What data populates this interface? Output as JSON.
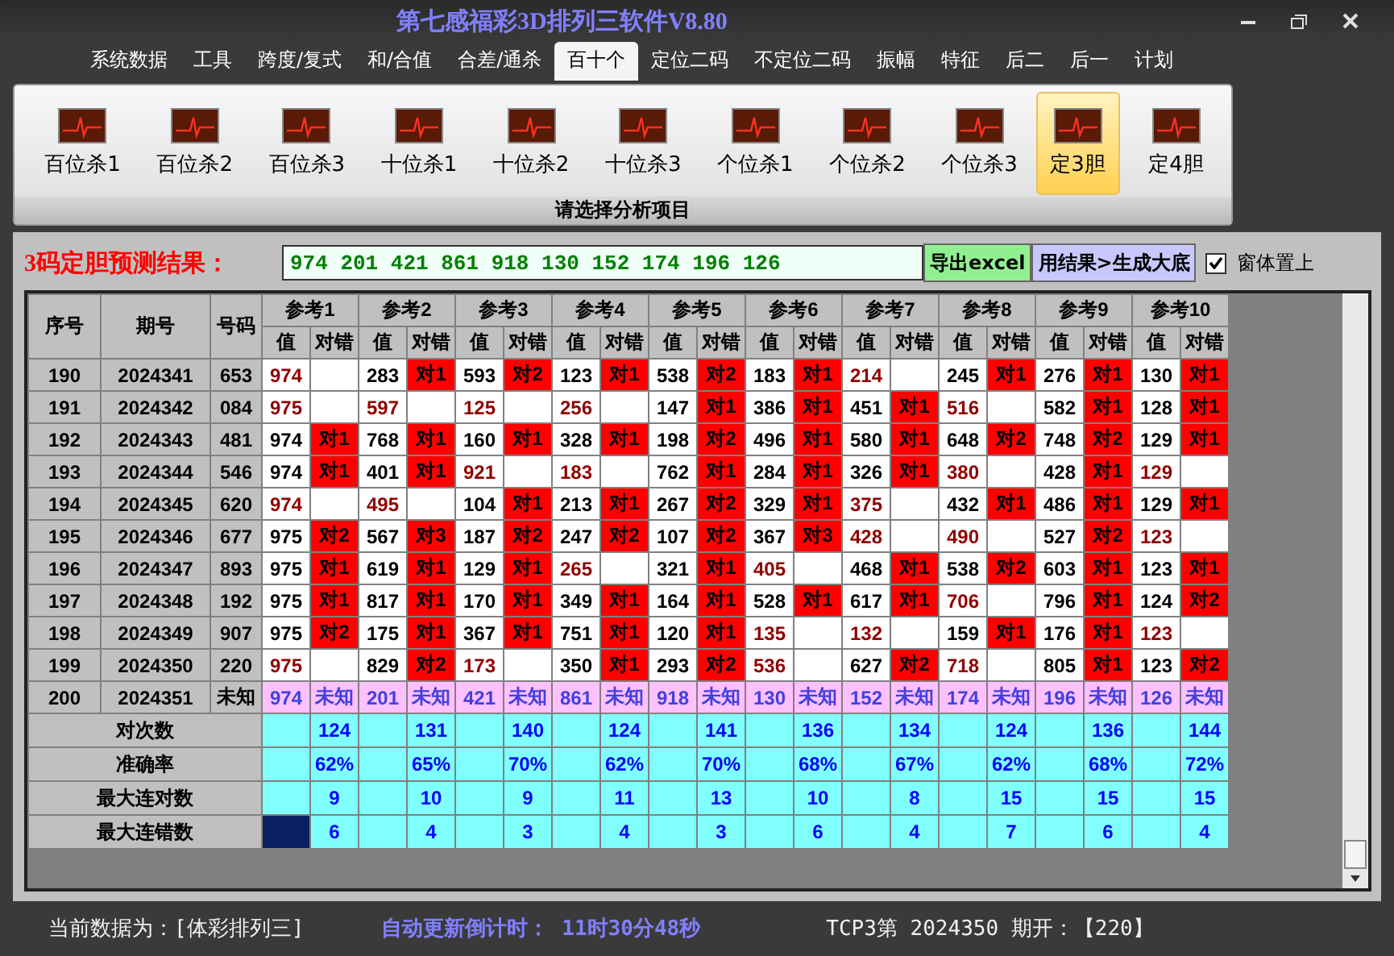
{
  "window": {
    "title": "第七感福彩3D排列三软件V8.80"
  },
  "menu": [
    {
      "label": "系统数据",
      "selected": false
    },
    {
      "label": "工具",
      "selected": false
    },
    {
      "label": "跨度/复式",
      "selected": false
    },
    {
      "label": "和/合值",
      "selected": false
    },
    {
      "label": "合差/通杀",
      "selected": false
    },
    {
      "label": "百十个",
      "selected": true
    },
    {
      "label": "定位二码",
      "selected": false
    },
    {
      "label": "不定位二码",
      "selected": false
    },
    {
      "label": "振幅",
      "selected": false
    },
    {
      "label": "特征",
      "selected": false
    },
    {
      "label": "后二",
      "selected": false
    },
    {
      "label": "后一",
      "selected": false
    },
    {
      "label": "计划",
      "selected": false
    }
  ],
  "ribbon": {
    "items": [
      {
        "label": "百位杀1",
        "selected": false
      },
      {
        "label": "百位杀2",
        "selected": false
      },
      {
        "label": "百位杀3",
        "selected": false
      },
      {
        "label": "十位杀1",
        "selected": false
      },
      {
        "label": "十位杀2",
        "selected": false
      },
      {
        "label": "十位杀3",
        "selected": false
      },
      {
        "label": "个位杀1",
        "selected": false
      },
      {
        "label": "个位杀2",
        "selected": false
      },
      {
        "label": "个位杀3",
        "selected": false
      },
      {
        "label": "定3胆",
        "selected": true
      },
      {
        "label": "定4胆",
        "selected": false
      }
    ],
    "caption": "请选择分析项目"
  },
  "result": {
    "label": "3码定胆预测结果：",
    "value": "974 201 421 861 918 130 152 174 196 126",
    "buttons": [
      "导出excel",
      "用结果>生成大底"
    ],
    "checkbox": {
      "label": "窗体置上",
      "checked": true
    }
  },
  "table": {
    "columns": [
      "序号",
      "期号",
      "号码"
    ],
    "groups": [
      {
        "label": "参考1",
        "subcolumns": [
          "值",
          "对错"
        ]
      },
      {
        "label": "参考2",
        "subcolumns": [
          "值",
          "对错"
        ]
      },
      {
        "label": "参考3",
        "subcolumns": [
          "值",
          "对错"
        ]
      },
      {
        "label": "参考4",
        "subcolumns": [
          "值",
          "对错"
        ]
      },
      {
        "label": "参考5",
        "subcolumns": [
          "值",
          "对错"
        ]
      },
      {
        "label": "参考6",
        "subcolumns": [
          "值",
          "对错"
        ]
      },
      {
        "label": "参考7",
        "subcolumns": [
          "值",
          "对错"
        ]
      },
      {
        "label": "参考8",
        "subcolumns": [
          "值",
          "对错"
        ]
      },
      {
        "label": "参考9",
        "subcolumns": [
          "值",
          "对错"
        ]
      },
      {
        "label": "参考10",
        "subcolumns": [
          "值",
          "对错"
        ]
      }
    ],
    "rows": [
      {
        "kind": "history",
        "seq": "190",
        "period": "2024341",
        "number": "653",
        "cells": [
          {
            "value": "974",
            "hit": false
          },
          {
            "value": "283",
            "hit": true,
            "result": "对1"
          },
          {
            "value": "593",
            "hit": true,
            "result": "对2"
          },
          {
            "value": "123",
            "hit": true,
            "result": "对1"
          },
          {
            "value": "538",
            "hit": true,
            "result": "对2"
          },
          {
            "value": "183",
            "hit": true,
            "result": "对1"
          },
          {
            "value": "214",
            "hit": false
          },
          {
            "value": "245",
            "hit": true,
            "result": "对1"
          },
          {
            "value": "276",
            "hit": true,
            "result": "对1"
          },
          {
            "value": "130",
            "hit": true,
            "result": "对1"
          }
        ]
      },
      {
        "kind": "history",
        "seq": "191",
        "period": "2024342",
        "number": "084",
        "cells": [
          {
            "value": "975",
            "hit": false
          },
          {
            "value": "597",
            "hit": false
          },
          {
            "value": "125",
            "hit": false
          },
          {
            "value": "256",
            "hit": false
          },
          {
            "value": "147",
            "hit": true,
            "result": "对1"
          },
          {
            "value": "386",
            "hit": true,
            "result": "对1"
          },
          {
            "value": "451",
            "hit": true,
            "result": "对1"
          },
          {
            "value": "516",
            "hit": false
          },
          {
            "value": "582",
            "hit": true,
            "result": "对1"
          },
          {
            "value": "128",
            "hit": true,
            "result": "对1"
          }
        ]
      },
      {
        "kind": "history",
        "seq": "192",
        "period": "2024343",
        "number": "481",
        "cells": [
          {
            "value": "974",
            "hit": true,
            "result": "对1"
          },
          {
            "value": "768",
            "hit": true,
            "result": "对1"
          },
          {
            "value": "160",
            "hit": true,
            "result": "对1"
          },
          {
            "value": "328",
            "hit": true,
            "result": "对1"
          },
          {
            "value": "198",
            "hit": true,
            "result": "对2"
          },
          {
            "value": "496",
            "hit": true,
            "result": "对1"
          },
          {
            "value": "580",
            "hit": true,
            "result": "对1"
          },
          {
            "value": "648",
            "hit": true,
            "result": "对2"
          },
          {
            "value": "748",
            "hit": true,
            "result": "对2"
          },
          {
            "value": "129",
            "hit": true,
            "result": "对1"
          }
        ]
      },
      {
        "kind": "history",
        "seq": "193",
        "period": "2024344",
        "number": "546",
        "cells": [
          {
            "value": "974",
            "hit": true,
            "result": "对1"
          },
          {
            "value": "401",
            "hit": true,
            "result": "对1"
          },
          {
            "value": "921",
            "hit": false
          },
          {
            "value": "183",
            "hit": false
          },
          {
            "value": "762",
            "hit": true,
            "result": "对1"
          },
          {
            "value": "284",
            "hit": true,
            "result": "对1"
          },
          {
            "value": "326",
            "hit": true,
            "result": "对1"
          },
          {
            "value": "380",
            "hit": false
          },
          {
            "value": "428",
            "hit": true,
            "result": "对1"
          },
          {
            "value": "129",
            "hit": false
          }
        ]
      },
      {
        "kind": "history",
        "seq": "194",
        "period": "2024345",
        "number": "620",
        "cells": [
          {
            "value": "974",
            "hit": false
          },
          {
            "value": "495",
            "hit": false
          },
          {
            "value": "104",
            "hit": true,
            "result": "对1"
          },
          {
            "value": "213",
            "hit": true,
            "result": "对1"
          },
          {
            "value": "267",
            "hit": true,
            "result": "对2"
          },
          {
            "value": "329",
            "hit": true,
            "result": "对1"
          },
          {
            "value": "375",
            "hit": false
          },
          {
            "value": "432",
            "hit": true,
            "result": "对1"
          },
          {
            "value": "486",
            "hit": true,
            "result": "对1"
          },
          {
            "value": "129",
            "hit": true,
            "result": "对1"
          }
        ]
      },
      {
        "kind": "history",
        "seq": "195",
        "period": "2024346",
        "number": "677",
        "cells": [
          {
            "value": "975",
            "hit": true,
            "result": "对2"
          },
          {
            "value": "567",
            "hit": true,
            "result": "对3"
          },
          {
            "value": "187",
            "hit": true,
            "result": "对2"
          },
          {
            "value": "247",
            "hit": true,
            "result": "对2"
          },
          {
            "value": "107",
            "hit": true,
            "result": "对2"
          },
          {
            "value": "367",
            "hit": true,
            "result": "对3"
          },
          {
            "value": "428",
            "hit": false
          },
          {
            "value": "490",
            "hit": false
          },
          {
            "value": "527",
            "hit": true,
            "result": "对2"
          },
          {
            "value": "123",
            "hit": false
          }
        ]
      },
      {
        "kind": "history",
        "seq": "196",
        "period": "2024347",
        "number": "893",
        "cells": [
          {
            "value": "975",
            "hit": true,
            "result": "对1"
          },
          {
            "value": "619",
            "hit": true,
            "result": "对1"
          },
          {
            "value": "129",
            "hit": true,
            "result": "对1"
          },
          {
            "value": "265",
            "hit": false
          },
          {
            "value": "321",
            "hit": true,
            "result": "对1"
          },
          {
            "value": "405",
            "hit": false
          },
          {
            "value": "468",
            "hit": true,
            "result": "对1"
          },
          {
            "value": "538",
            "hit": true,
            "result": "对2"
          },
          {
            "value": "603",
            "hit": true,
            "result": "对1"
          },
          {
            "value": "123",
            "hit": true,
            "result": "对1"
          }
        ]
      },
      {
        "kind": "history",
        "seq": "197",
        "period": "2024348",
        "number": "192",
        "cells": [
          {
            "value": "975",
            "hit": true,
            "result": "对1"
          },
          {
            "value": "817",
            "hit": true,
            "result": "对1"
          },
          {
            "value": "170",
            "hit": true,
            "result": "对1"
          },
          {
            "value": "349",
            "hit": true,
            "result": "对1"
          },
          {
            "value": "164",
            "hit": true,
            "result": "对1"
          },
          {
            "value": "528",
            "hit": true,
            "result": "对1"
          },
          {
            "value": "617",
            "hit": true,
            "result": "对1"
          },
          {
            "value": "706",
            "hit": false
          },
          {
            "value": "796",
            "hit": true,
            "result": "对1"
          },
          {
            "value": "124",
            "hit": true,
            "result": "对2"
          }
        ]
      },
      {
        "kind": "history",
        "seq": "198",
        "period": "2024349",
        "number": "907",
        "cells": [
          {
            "value": "975",
            "hit": true,
            "result": "对2"
          },
          {
            "value": "175",
            "hit": true,
            "result": "对1"
          },
          {
            "value": "367",
            "hit": true,
            "result": "对1"
          },
          {
            "value": "751",
            "hit": true,
            "result": "对1"
          },
          {
            "value": "120",
            "hit": true,
            "result": "对1"
          },
          {
            "value": "135",
            "hit": false
          },
          {
            "value": "132",
            "hit": false
          },
          {
            "value": "159",
            "hit": true,
            "result": "对1"
          },
          {
            "value": "176",
            "hit": true,
            "result": "对1"
          },
          {
            "value": "123",
            "hit": false
          }
        ]
      },
      {
        "kind": "history",
        "seq": "199",
        "period": "2024350",
        "number": "220",
        "cells": [
          {
            "value": "975",
            "hit": false
          },
          {
            "value": "829",
            "hit": true,
            "result": "对2"
          },
          {
            "value": "173",
            "hit": false
          },
          {
            "value": "350",
            "hit": true,
            "result": "对1"
          },
          {
            "value": "293",
            "hit": true,
            "result": "对2"
          },
          {
            "value": "536",
            "hit": false
          },
          {
            "value": "627",
            "hit": true,
            "result": "对2"
          },
          {
            "value": "718",
            "hit": false
          },
          {
            "value": "805",
            "hit": true,
            "result": "对1"
          },
          {
            "value": "123",
            "hit": true,
            "result": "对2"
          }
        ]
      },
      {
        "kind": "forecast",
        "seq": "200",
        "period": "2024351",
        "number": "未知",
        "cells": [
          {
            "value": "974",
            "result": "未知"
          },
          {
            "value": "201",
            "result": "未知"
          },
          {
            "value": "421",
            "result": "未知"
          },
          {
            "value": "861",
            "result": "未知"
          },
          {
            "value": "918",
            "result": "未知"
          },
          {
            "value": "130",
            "result": "未知"
          },
          {
            "value": "152",
            "result": "未知"
          },
          {
            "value": "174",
            "result": "未知"
          },
          {
            "value": "196",
            "result": "未知"
          },
          {
            "value": "126",
            "result": "未知"
          }
        ]
      }
    ],
    "summary": [
      {
        "label": "对次数",
        "selected": false,
        "values": [
          "124",
          "131",
          "140",
          "124",
          "141",
          "136",
          "134",
          "124",
          "136",
          "144"
        ]
      },
      {
        "label": "准确率",
        "selected": false,
        "values": [
          "62%",
          "65%",
          "70%",
          "62%",
          "70%",
          "68%",
          "67%",
          "62%",
          "68%",
          "72%"
        ]
      },
      {
        "label": "最大连对数",
        "selected": false,
        "values": [
          "9",
          "10",
          "9",
          "11",
          "13",
          "10",
          "8",
          "15",
          "15",
          "15"
        ]
      },
      {
        "label": "最大连错数",
        "selected": true,
        "values": [
          "6",
          "4",
          "3",
          "4",
          "3",
          "6",
          "4",
          "7",
          "6",
          "4"
        ]
      }
    ]
  },
  "status_bar": {
    "data_source": "当前数据为：[体彩排列三]",
    "countdown_label": "自动更新倒计时：",
    "countdown": "11时30分48秒",
    "latest": "TCP3第 2024350 期开：【220】"
  }
}
